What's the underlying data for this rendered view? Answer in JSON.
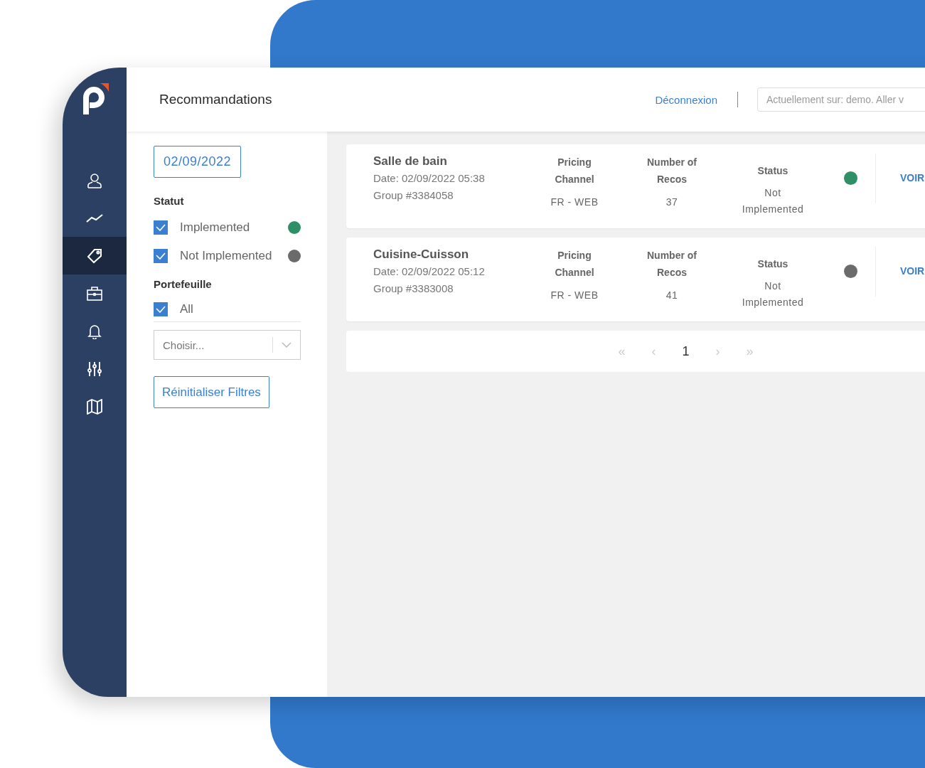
{
  "header": {
    "title": "Recommandations",
    "logout": "Déconnexion",
    "search_placeholder": "Actuellement sur: demo. Aller v"
  },
  "sidebar": {
    "items": [
      {
        "kind": "user",
        "selected": false
      },
      {
        "kind": "chart",
        "selected": false
      },
      {
        "kind": "tag",
        "selected": true
      },
      {
        "kind": "briefcase",
        "selected": false
      },
      {
        "kind": "bell",
        "selected": false
      },
      {
        "kind": "sliders",
        "selected": false
      },
      {
        "kind": "map",
        "selected": false
      }
    ]
  },
  "filters": {
    "date": "02/09/2022",
    "status_label": "Statut",
    "status_options": [
      {
        "label": "Implemented",
        "checked": true,
        "color": "#2f8f66"
      },
      {
        "label": "Not Implemented",
        "checked": true,
        "color": "#6b6b6b"
      }
    ],
    "portfolio_label": "Portefeuille",
    "portfolio_options": [
      {
        "label": "All",
        "checked": true
      }
    ],
    "select_placeholder": "Choisir...",
    "reset": "Réinitialiser Filtres"
  },
  "cards": [
    {
      "name": "Salle de bain",
      "date": "Date: 02/09/2022 05:38",
      "group": "Group #3384058",
      "channel_header": "Pricing Channel",
      "channel": "FR - WEB",
      "recos_header": "Number of Recos",
      "recos": "37",
      "status_header": "Status",
      "status": "Not Implemented",
      "color": "#2f8f66",
      "action": "VOIR"
    },
    {
      "name": "Cuisine-Cuisson",
      "date": "Date: 02/09/2022 05:12",
      "group": "Group #3383008",
      "channel_header": "Pricing Channel",
      "channel": "FR - WEB",
      "recos_header": "Number of Recos",
      "recos": "41",
      "status_header": "Status",
      "status": "Not Implemented",
      "color": "#6b6b6b",
      "action": "VOIR"
    }
  ],
  "pagination": {
    "first": "«",
    "prev": "‹",
    "page": "1",
    "next": "›",
    "last": "»"
  }
}
